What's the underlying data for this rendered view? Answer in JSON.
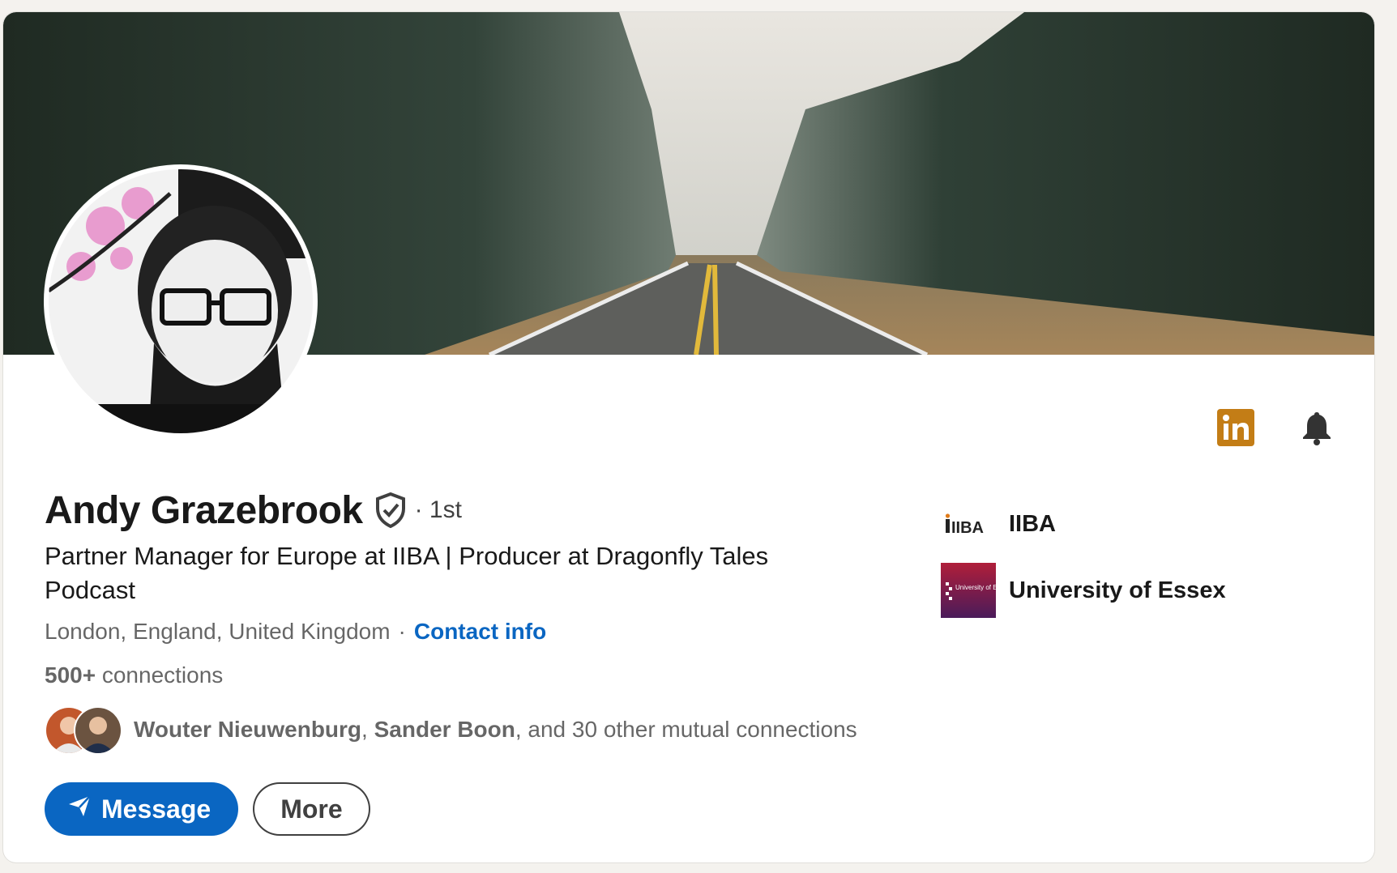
{
  "profile": {
    "name": "Andy Grazebrook",
    "degree": "· 1st",
    "headline": "Partner Manager for Europe at IIBA | Producer at Dragonfly Tales Podcast",
    "location": "London, England, United Kingdom",
    "separator": "·",
    "contact_label": "Contact info",
    "connections_count": "500+",
    "connections_label": "connections"
  },
  "mutual": {
    "person1": "Wouter Nieuwenburg",
    "comma": ",",
    "person2": "Sander Boon",
    "rest": ", and 30 other mutual connections"
  },
  "buttons": {
    "message": "Message",
    "more": "More"
  },
  "orgs": [
    {
      "name": "IIBA",
      "logo_text": "IIBA"
    },
    {
      "name": "University of Essex",
      "logo_text": "University of Essex"
    }
  ],
  "icons": {
    "linkedin": "linkedin-icon",
    "bell": "bell-icon",
    "verified": "verified-shield-icon",
    "send": "send-icon"
  },
  "colors": {
    "accent": "#0a66c2",
    "linkedin_badge": "#c37d16",
    "essex": "#8a1538"
  }
}
